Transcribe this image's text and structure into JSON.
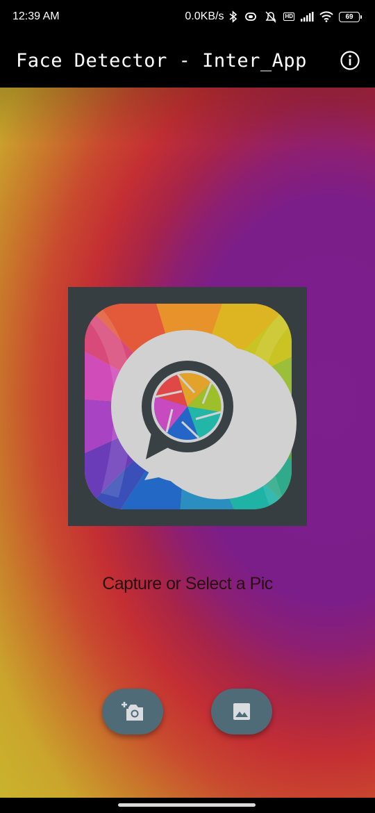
{
  "status_bar": {
    "time": "12:39 AM",
    "net_speed": "0.0KB/s",
    "hd_badge": "HD",
    "battery_level": "69",
    "icons": [
      "bluetooth-icon",
      "vibrate-icon",
      "muted-alarm-icon",
      "volte-icon",
      "signal-icon",
      "wifi-icon",
      "battery-icon"
    ]
  },
  "app_bar": {
    "title": "Face Detector - Inter_App",
    "info_icon": "info-icon"
  },
  "main": {
    "caption": "Capture or Select a Pic",
    "logo": "app-logo-aperture-chat"
  },
  "actions": {
    "capture": {
      "icon": "add-photo-camera-icon"
    },
    "select": {
      "icon": "image-gallery-icon"
    }
  },
  "colors": {
    "app_bar": "#000000",
    "logo_frame": "#363e41",
    "fab": "#4f6b78",
    "background_center": "#7d1f8c",
    "background_ring": "#c42f33",
    "background_outer": "#c9b62d"
  }
}
